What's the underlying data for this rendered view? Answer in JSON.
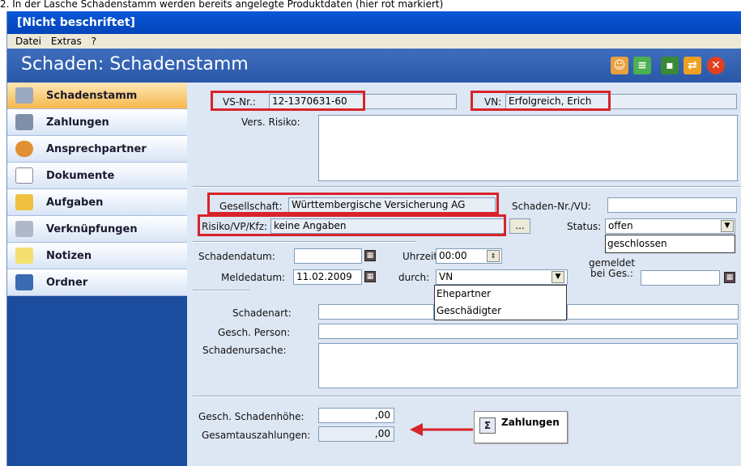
{
  "caption": "2. In der Lasche Schadenstamm werden bereits angelegte Produktdaten (hier rot markiert)",
  "window": {
    "title": "[Nicht beschriftet]"
  },
  "menu": [
    "Datei",
    "Extras",
    "?"
  ],
  "header": {
    "title": "Schaden: Schadenstamm"
  },
  "toolbar_icons": [
    "person-add-icon",
    "document-export-icon",
    "save-icon",
    "refresh-icon",
    "close-icon"
  ],
  "nav": [
    {
      "label": "Schadenstamm",
      "icon": "wrench-icon",
      "active": true
    },
    {
      "label": "Zahlungen",
      "icon": "payments-icon"
    },
    {
      "label": "Ansprechpartner",
      "icon": "person-icon"
    },
    {
      "label": "Dokumente",
      "icon": "document-icon"
    },
    {
      "label": "Aufgaben",
      "icon": "task-icon"
    },
    {
      "label": "Verknüpfungen",
      "icon": "link-icon"
    },
    {
      "label": "Notizen",
      "icon": "notes-icon"
    },
    {
      "label": "Ordner",
      "icon": "folder-icon"
    }
  ],
  "form": {
    "vsnr_label": "VS-Nr.:",
    "vsnr_value": "12-1370631-60",
    "vn_label": "VN:",
    "vn_value": "Erfolgreich, Erich",
    "vers_risiko_label": "Vers. Risiko:",
    "gesellschaft_label": "Gesellschaft:",
    "gesellschaft_value": "Württembergische Versicherung AG",
    "schaden_nr_label": "Schaden-Nr./VU:",
    "risiko_label": "Risiko/VP/Kfz:",
    "risiko_value": "keine Angaben",
    "dots_label": "...",
    "status_label": "Status:",
    "status_value": "offen",
    "status_options": [
      "geschlossen"
    ],
    "schadendatum_label": "Schadendatum:",
    "uhrzeit_label": "Uhrzeit:",
    "uhrzeit_value": "00:00",
    "gemeldet_label_1": "gemeldet",
    "gemeldet_label_2": "bei Ges.:",
    "meldedatum_label": "Meldedatum:",
    "meldedatum_value": "11.02.2009",
    "durch_label": "durch:",
    "durch_value": "VN",
    "durch_options": [
      "Ehepartner",
      "Geschädigter"
    ],
    "schadenart_label": "Schadenart:",
    "gesch_person_label": "Gesch. Person:",
    "schadenursache_label": "Schadenursache:",
    "schadenhoehe_label": "Gesch. Schadenhöhe:",
    "schadenhoehe_value": ",00",
    "gesamtauszahlungen_label": "Gesamtauszahlungen:",
    "gesamtauszahlungen_value": ",00",
    "zahlungen_button": "Zahlungen",
    "sigma": "Σ"
  },
  "colors": {
    "highlight": "#d8232a",
    "header": "#2f5fb0",
    "title_bar": "#0a58d8"
  }
}
